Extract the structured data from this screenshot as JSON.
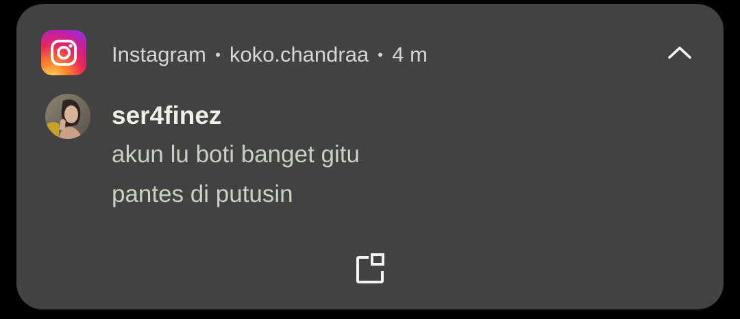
{
  "notification": {
    "app_name": "Instagram",
    "account": "koko.chandraa",
    "time": "4 m",
    "sender": "ser4finez",
    "message_lines": [
      "akun lu boti banget gitu",
      "pantes di putusin"
    ]
  },
  "icons": {
    "app": "instagram-icon",
    "collapse": "chevron-up-icon",
    "expand": "open-window-icon",
    "avatar": "user-avatar"
  },
  "colors": {
    "background": "#000000",
    "card": "#424242",
    "header_text": "#d4d7d2",
    "sender_text": "#eef1ea",
    "message_text": "#c9d0c4"
  }
}
